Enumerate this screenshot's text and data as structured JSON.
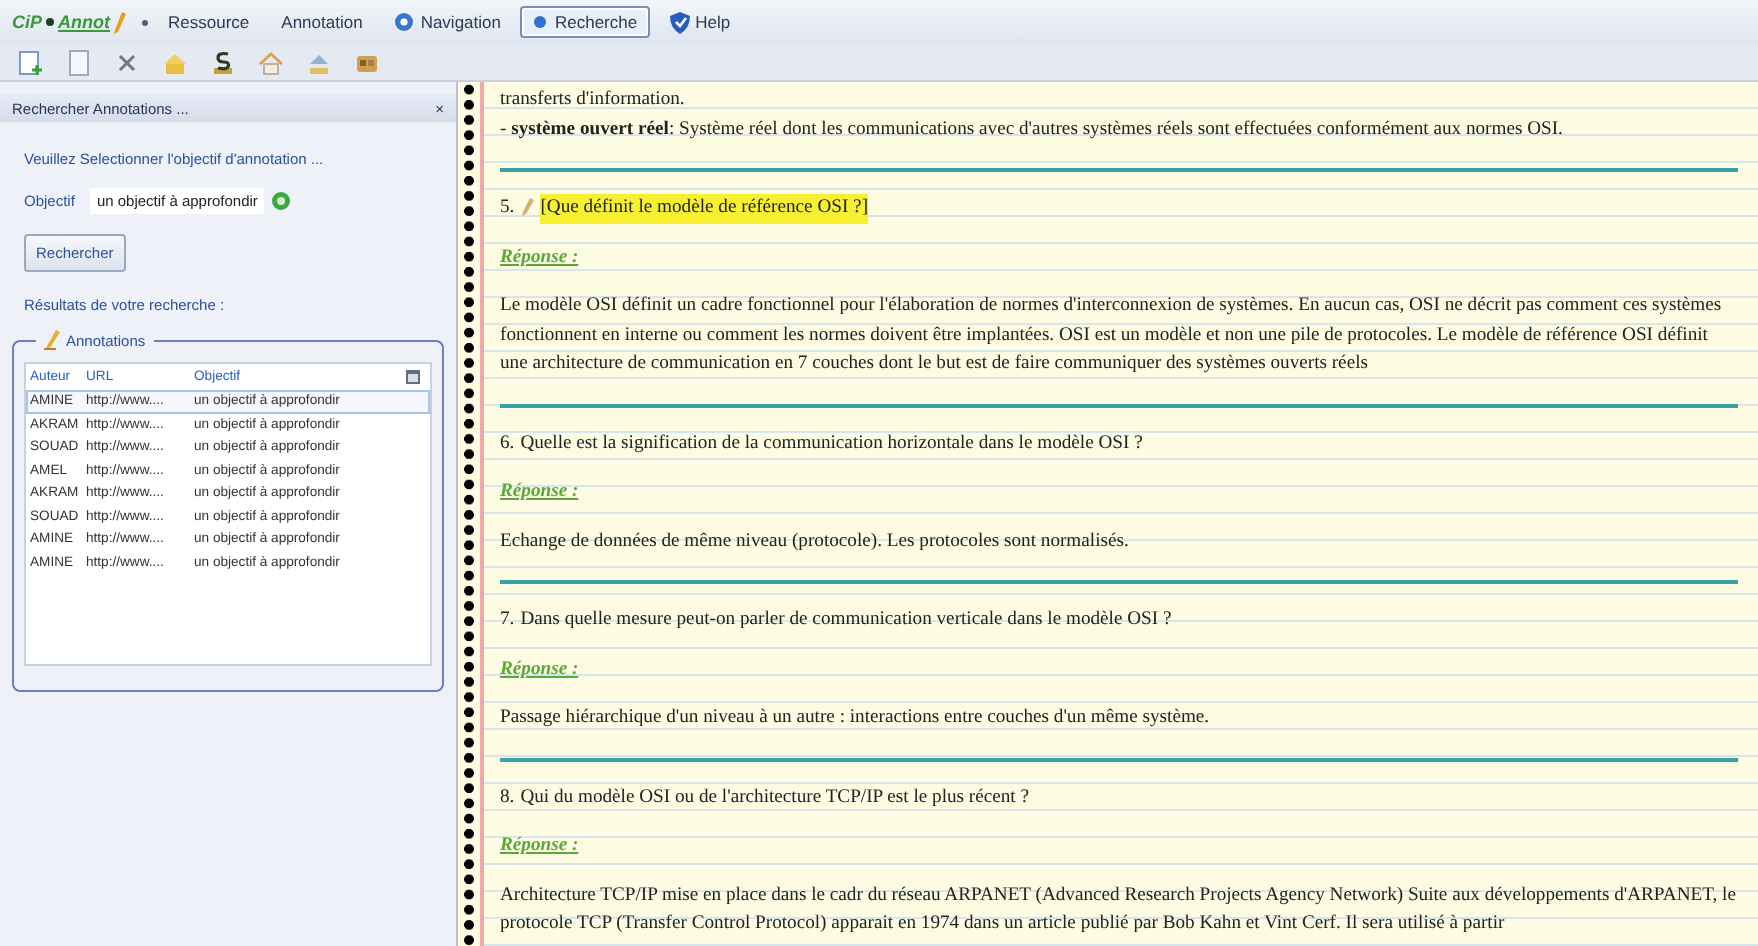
{
  "logo": {
    "left": "CiP",
    "right": "Annot"
  },
  "menu": [
    {
      "label": "Ressource",
      "selected": false
    },
    {
      "label": "Annotation",
      "selected": false
    },
    {
      "label": "Navigation",
      "selected": false
    },
    {
      "label": "Recherche",
      "selected": true
    },
    {
      "label": "Help",
      "selected": false
    }
  ],
  "search_panel": {
    "title": "Rechercher Annotations ...",
    "close": "×",
    "instruction": "Veuillez Selectionner l'objectif d'annotation ...",
    "objective_label": "Objectif",
    "objective_value": "un objectif à approfondir",
    "search_button": "Rechercher",
    "results_label": "Résultats de votre recherche :",
    "group_title": "Annotations",
    "columns": [
      "Auteur",
      "URL",
      "Objectif"
    ],
    "rows": [
      {
        "cells": [
          "AMINE",
          "http://www....",
          "un objectif à approfondir"
        ],
        "selected": true
      },
      {
        "cells": [
          "AKRAM",
          "http://www....",
          "un objectif à approfondir"
        ],
        "selected": false
      },
      {
        "cells": [
          "SOUAD",
          "http://www....",
          "un objectif à approfondir"
        ],
        "selected": false
      },
      {
        "cells": [
          "AMEL",
          "http://www....",
          "un objectif à approfondir"
        ],
        "selected": false
      },
      {
        "cells": [
          "AKRAM",
          "http://www....",
          "un objectif à approfondir"
        ],
        "selected": false
      },
      {
        "cells": [
          "SOUAD",
          "http://www....",
          "un objectif à approfondir"
        ],
        "selected": false
      },
      {
        "cells": [
          "AMINE",
          "http://www....",
          "un objectif à approfondir"
        ],
        "selected": false
      },
      {
        "cells": [
          "AMINE",
          "http://www....",
          "un objectif à approfondir"
        ],
        "selected": false
      }
    ]
  },
  "document": {
    "intro": [
      "transferts d'information.",
      "- **système ouvert réel**: Système réel dont les communications avec d'autres systèmes réels sont effectuées conformément aux normes OSI."
    ],
    "questions": [
      {
        "number": "5.",
        "question": "[Que définit le modèle de référence OSI ?]",
        "annotated": true,
        "response_label": "Réponse :",
        "answer": "Le modèle OSI définit un cadre fonctionnel pour l'élaboration de normes d'interconnexion de systèmes. En aucun cas, OSI ne décrit pas comment ces systèmes fonctionnent en interne ou comment les normes doivent être implantées. OSI est un modèle et non une pile de protocoles. Le modèle de référence OSI définit une architecture de communication en 7 couches dont le but est de faire communiquer des systèmes ouverts réels"
      },
      {
        "number": "6.",
        "question": "Quelle est la signification de la communication horizontale dans le modèle OSI ?",
        "annotated": false,
        "response_label": "Réponse :",
        "answer": "Echange de données de même niveau (protocole). Les protocoles sont normalisés."
      },
      {
        "number": "7.",
        "question": "Dans quelle mesure peut-on parler de communication verticale dans le modèle OSI ?",
        "annotated": false,
        "response_label": "Réponse :",
        "answer": "Passage hiérarchique d'un niveau à un autre : interactions entre couches d'un même système."
      },
      {
        "number": "8.",
        "question": "Qui du modèle OSI ou de l'architecture TCP/IP est le plus récent ?",
        "annotated": false,
        "response_label": "Réponse :",
        "answer": "Architecture TCP/IP mise en place dans le cadr du réseau ARPANET  (Advanced Research Projects Agency Network) Suite aux développements d'ARPANET, le protocole TCP (Transfer Control Protocol) apparait en 1974 dans un article publié par Bob Kahn et Vint Cerf. Il sera utilisé à partir"
      }
    ]
  }
}
